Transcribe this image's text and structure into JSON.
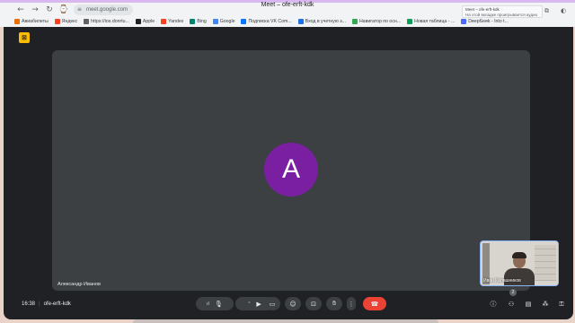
{
  "browser": {
    "url": "meet.google.com",
    "title": "Meet – ofe-erft-kdk",
    "tooltip": {
      "title": "Meet – ofe-erft-kdk",
      "subtitle": "На этой вкладке проигрывается аудио"
    },
    "bookmarks": [
      {
        "label": "Авиабилеты",
        "color": "#e8710a"
      },
      {
        "label": "Яндекс",
        "color": "#fc3f1d"
      },
      {
        "label": "https://ios.donrtu...",
        "color": "#5f6368"
      },
      {
        "label": "Apple",
        "color": "#202124"
      },
      {
        "label": "Yandex",
        "color": "#fc3f1d"
      },
      {
        "label": "Bing",
        "color": "#008373"
      },
      {
        "label": "Google",
        "color": "#4285f4"
      },
      {
        "label": "Подписка VK Com...",
        "color": "#0077ff"
      },
      {
        "label": "Вход в учетную з...",
        "color": "#1a73e8"
      },
      {
        "label": "Навигатор по осн...",
        "color": "#34a853"
      },
      {
        "label": "Новая таблица - ...",
        "color": "#0f9d58"
      },
      {
        "label": "DeepSeek - Into t...",
        "color": "#4d6bfe"
      }
    ]
  },
  "meet": {
    "main_participant": {
      "initial": "A",
      "name": "Александр Иванов",
      "avatar_color": "#7b1fa2"
    },
    "self_participant": {
      "name": "Иван Калашников"
    },
    "time": "16:38",
    "meeting_code": "ofe-erft-kdk",
    "people_count": "2"
  }
}
